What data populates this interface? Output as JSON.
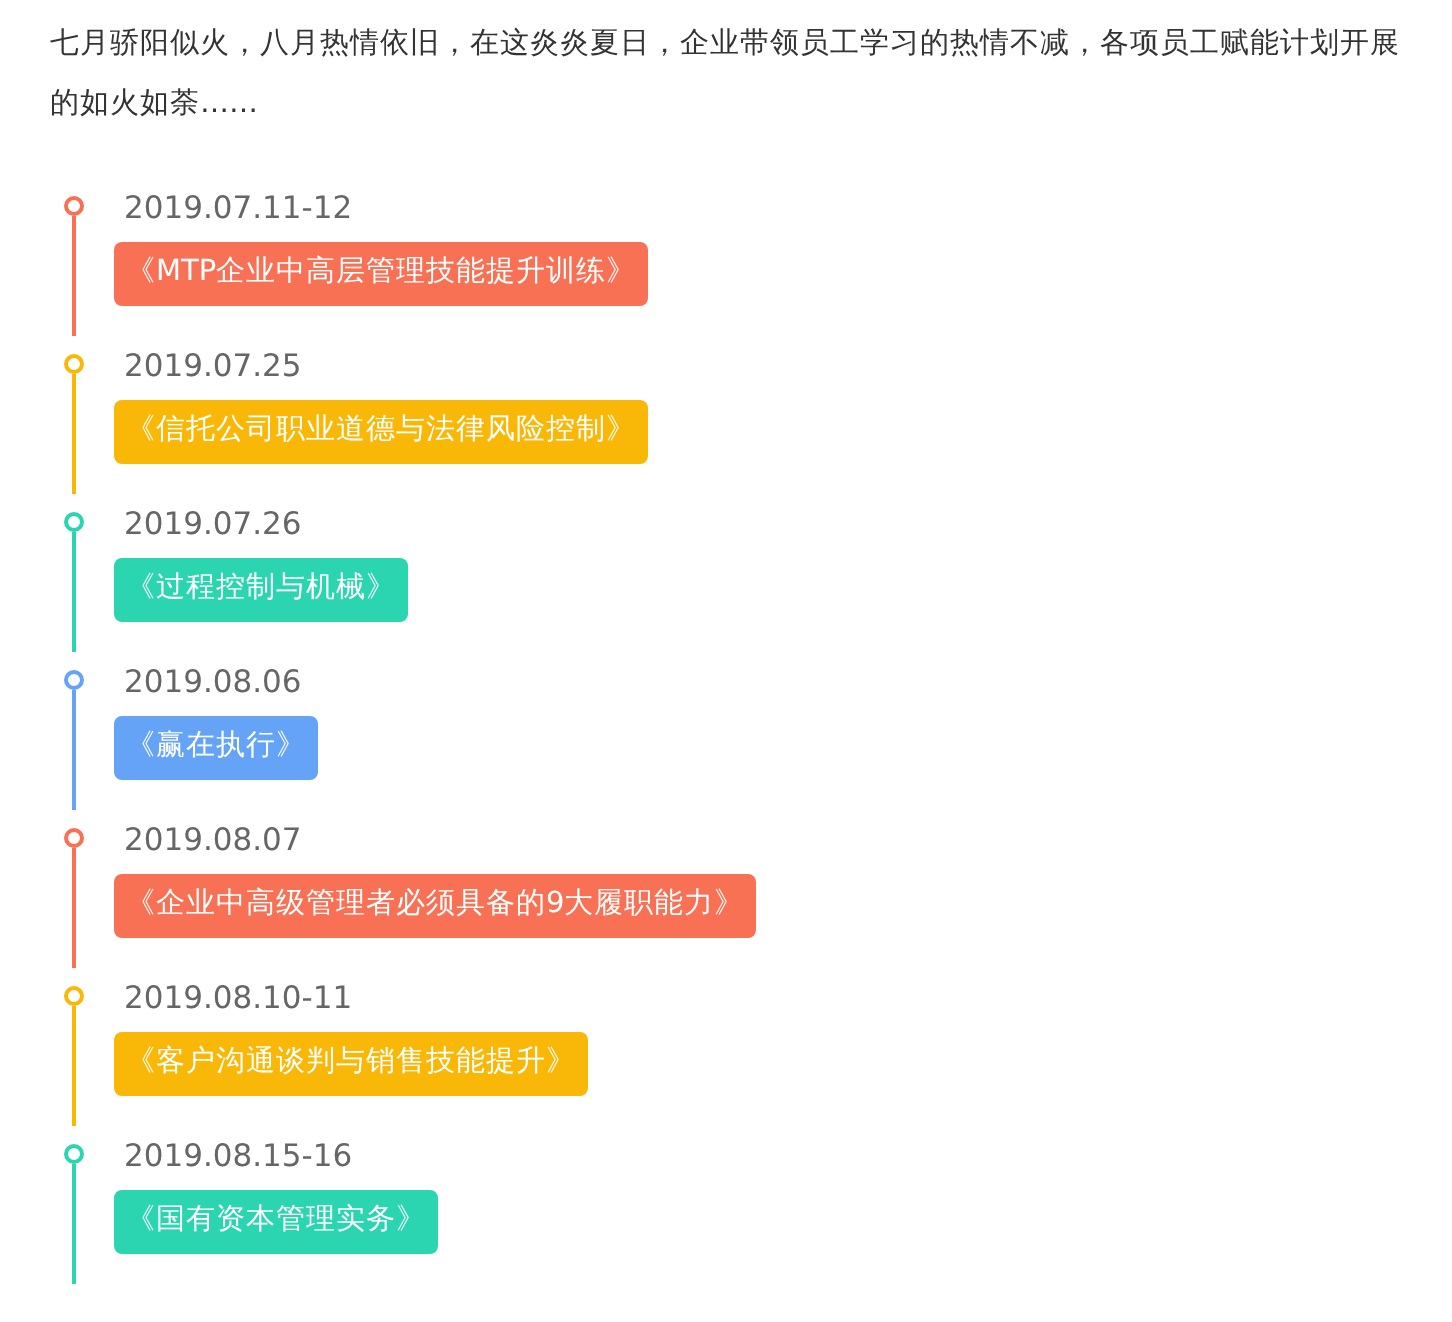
{
  "intro": "七月骄阳似火，八月热情依旧，在这炎炎夏日，企业带领员工学习的热情不减，各项员工赋能计划开展的如火如荼……",
  "timeline": [
    {
      "date": "2019.07.11-12",
      "course": "《MTP企业中高层管理技能提升训练》",
      "color": "#f87155"
    },
    {
      "date": "2019.07.25",
      "course": "《信托公司职业道德与法律风险控制》",
      "color": "#f9b707"
    },
    {
      "date": "2019.07.26",
      "course": "《过程控制与机械》",
      "color": "#2ad5b0"
    },
    {
      "date": "2019.08.06",
      "course": "《赢在执行》",
      "color": "#64a3f6"
    },
    {
      "date": "2019.08.07",
      "course": "《企业中高级管理者必须具备的9大履职能力》",
      "color": "#f87155"
    },
    {
      "date": "2019.08.10-11",
      "course": "《客户沟通谈判与销售技能提升》",
      "color": "#f9b707"
    },
    {
      "date": "2019.08.15-16",
      "course": "《国有资本管理实务》",
      "color": "#2ad5b0"
    }
  ]
}
